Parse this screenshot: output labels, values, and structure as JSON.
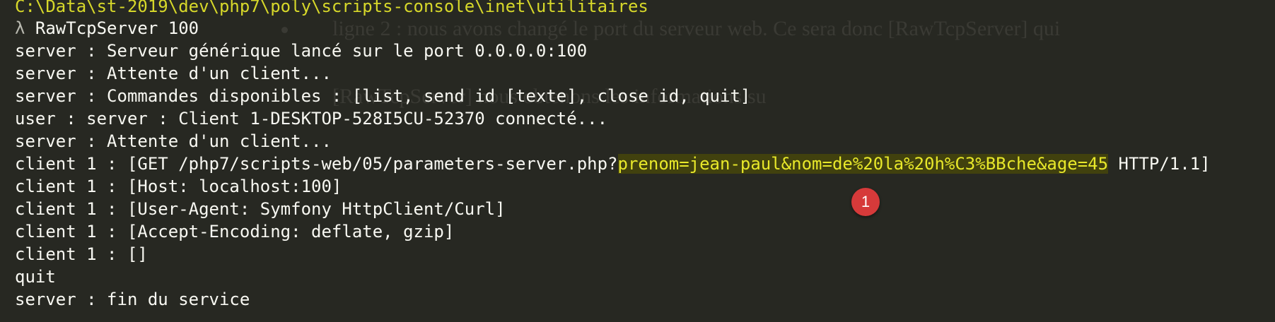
{
  "background_document": {
    "line1": "ligne 2 : nous avons changé le port du serveur web. Ce sera donc [RawTcpServer] qui",
    "line2": "[RawTcpServer] nous obtenons les informations su"
  },
  "terminal": {
    "path": "C:\\Data\\st-2019\\dev\\php7\\poly\\scripts-console\\inet\\utilitaires",
    "prompt_symbol": "λ",
    "command": " RawTcpServer 100",
    "lines": [
      "server : Serveur générique lancé sur le port 0.0.0.0:100",
      "server : Attente d'un client...",
      "server : Commandes disponibles : [list, send id [texte], close id, quit]",
      "user : server : Client 1-DESKTOP-528I5CU-52370 connecté...",
      "server : Attente d'un client..."
    ],
    "request_line": {
      "prefix": "client 1 : [GET /php7/scripts-web/05/parameters-server.php?",
      "highlight": "prenom=jean-paul&nom=de%20la%20h%C3%BBche&age=45",
      "suffix": " HTTP/1.1]"
    },
    "lines_after": [
      "client 1 : [Host: localhost:100]",
      "client 1 : [User-Agent: Symfony HttpClient/Curl]",
      "client 1 : [Accept-Encoding: deflate, gzip]",
      "client 1 : []",
      "quit",
      "server : fin du service"
    ]
  },
  "annotation": {
    "badge_number": "1"
  },
  "colors": {
    "background": "#272822",
    "text": "#f8f8f2",
    "path": "#d7d82a",
    "highlight_text": "#e8e82a",
    "highlight_bg": "#41410e",
    "badge": "#d63a3a"
  }
}
